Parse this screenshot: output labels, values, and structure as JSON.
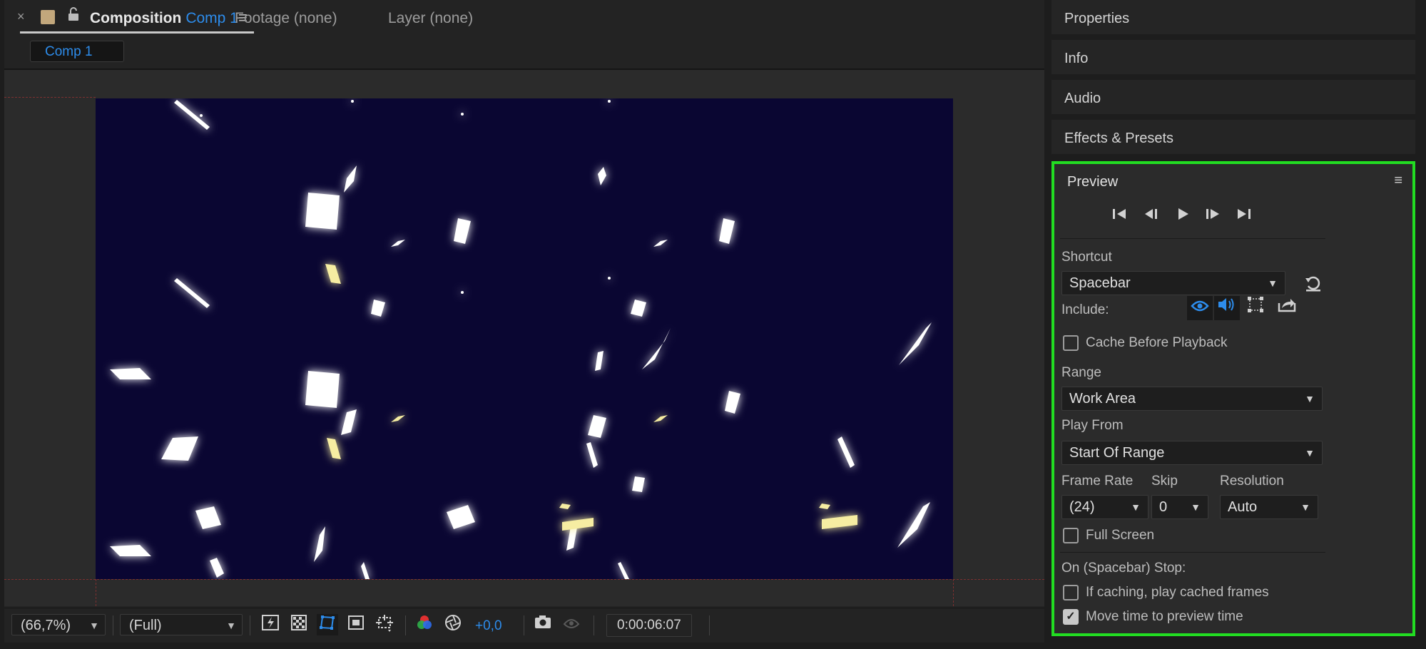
{
  "composition_tab": {
    "close": "×",
    "title_prefix": "Composition",
    "comp_name": "Comp 1",
    "menu": "≡"
  },
  "footage_tab": "Footage (none)",
  "layer_tab": "Layer (none)",
  "comp_chip": "Comp 1",
  "viewer_toolbar": {
    "magnification": "(66,7%)",
    "resolution": "(Full)",
    "exposure": "+0,0",
    "timecode": "0:00:06:07"
  },
  "panels": {
    "properties": "Properties",
    "info": "Info",
    "audio": "Audio",
    "effects": "Effects & Presets"
  },
  "preview": {
    "title": "Preview",
    "shortcut_label": "Shortcut",
    "shortcut_value": "Spacebar",
    "include_label": "Include:",
    "cache_label": "Cache Before Playback",
    "range_label": "Range",
    "range_value": "Work Area",
    "play_from_label": "Play From",
    "play_from_value": "Start Of Range",
    "frame_rate_label": "Frame Rate",
    "frame_rate_value": "(24)",
    "skip_label": "Skip",
    "skip_value": "0",
    "resolution_label": "Resolution",
    "resolution_value": "Auto",
    "full_screen_label": "Full Screen",
    "stop_label": "On (Spacebar) Stop:",
    "if_caching_label": "If caching, play cached frames",
    "move_time_label": "Move time to preview time",
    "cache_checked": false,
    "full_screen_checked": false,
    "if_caching_checked": false,
    "move_time_checked": true
  },
  "colors": {
    "accent_blue": "#2d8ceb",
    "highlight_green": "#22dd22",
    "comp_background": "#0a0632",
    "label_swatch": "#c2a77c"
  },
  "icons": {
    "transport": [
      "first-frame-icon",
      "previous-frame-icon",
      "play-icon",
      "next-frame-icon",
      "last-frame-icon"
    ],
    "include": [
      "video-eye-icon",
      "audio-speaker-icon",
      "overlays-icon",
      "export-icon"
    ]
  }
}
